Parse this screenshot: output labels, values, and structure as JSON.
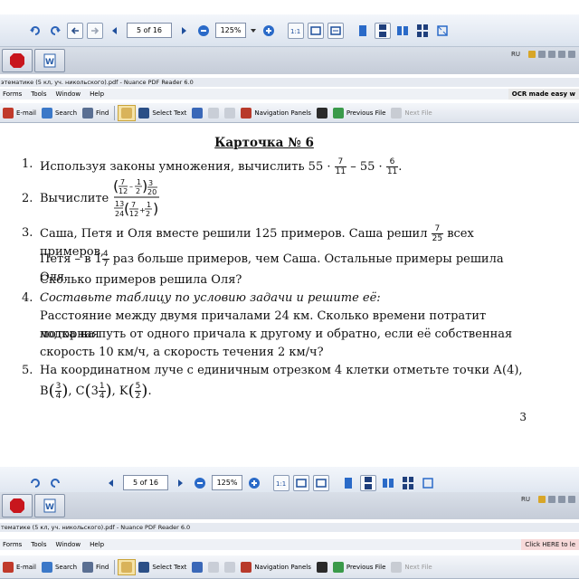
{
  "nav_toolbar": {
    "page_indicator": "5 of 16",
    "zoom": "125%"
  },
  "taskbar": {
    "lang": "RU"
  },
  "window": {
    "title_top": "этематике (5 кл, уч. никольского).pdf - Nuance PDF Reader 6.0",
    "title_bottom": "тематике (5 кл, уч. никольского).pdf - Nuance PDF Reader 6.0"
  },
  "menu": {
    "items": [
      "Forms",
      "Tools",
      "Window",
      "Help"
    ],
    "banner_top": "OCR made easy w",
    "banner_bottom": "Click HERE to le"
  },
  "commands": {
    "email": "E-mail",
    "search": "Search",
    "find": "Find",
    "select_text": "Select Text",
    "navigation_panels": "Navigation Panels",
    "previous_file": "Previous File",
    "next_file": "Next File"
  },
  "document": {
    "title": "Карточка № 6",
    "item1_num": "1.",
    "item1_text": "Используя законы умножения, вычислить 55 ·",
    "item1_f1n": "7",
    "item1_f1d": "11",
    "item1_mid": " – 55 ·",
    "item1_f2n": "6",
    "item1_f2d": "11",
    "item2_num": "2.",
    "item2_text": "Вычислите",
    "item3_num": "3.",
    "item3_line1a": "Саша, Петя и Оля вместе решили 125 примеров. Саша решил",
    "item3_f1n": "7",
    "item3_f1d": "25",
    "item3_line1b": "всех примеров,",
    "item3_line2a": "Петя – в 1",
    "item3_f2n": "4",
    "item3_f2d": "7",
    "item3_line2b": "раз больше примеров, чем Саша. Остальные примеры решила Оля.",
    "item3_line3": "Сколько примеров решила Оля?",
    "item4_num": "4.",
    "item4_heading": "Составьте таблицу по условию задачи и решите её:",
    "item4_line1": "Расстояние между двумя причалами 24 км. Сколько времени потратит моторная",
    "item4_line2": "лодка на путь от одного причала к другому и обратно, если её собственная",
    "item4_line3": "скорость 10 км/ч, а скорость течения 2 км/ч?",
    "item5_num": "5.",
    "item5_line1": "На координатном луче с единичным отрезком 4 клетки отметьте точки А(4),",
    "item5_b": "B",
    "item5_c": "C",
    "item5_k": "K",
    "page_number": "3"
  }
}
